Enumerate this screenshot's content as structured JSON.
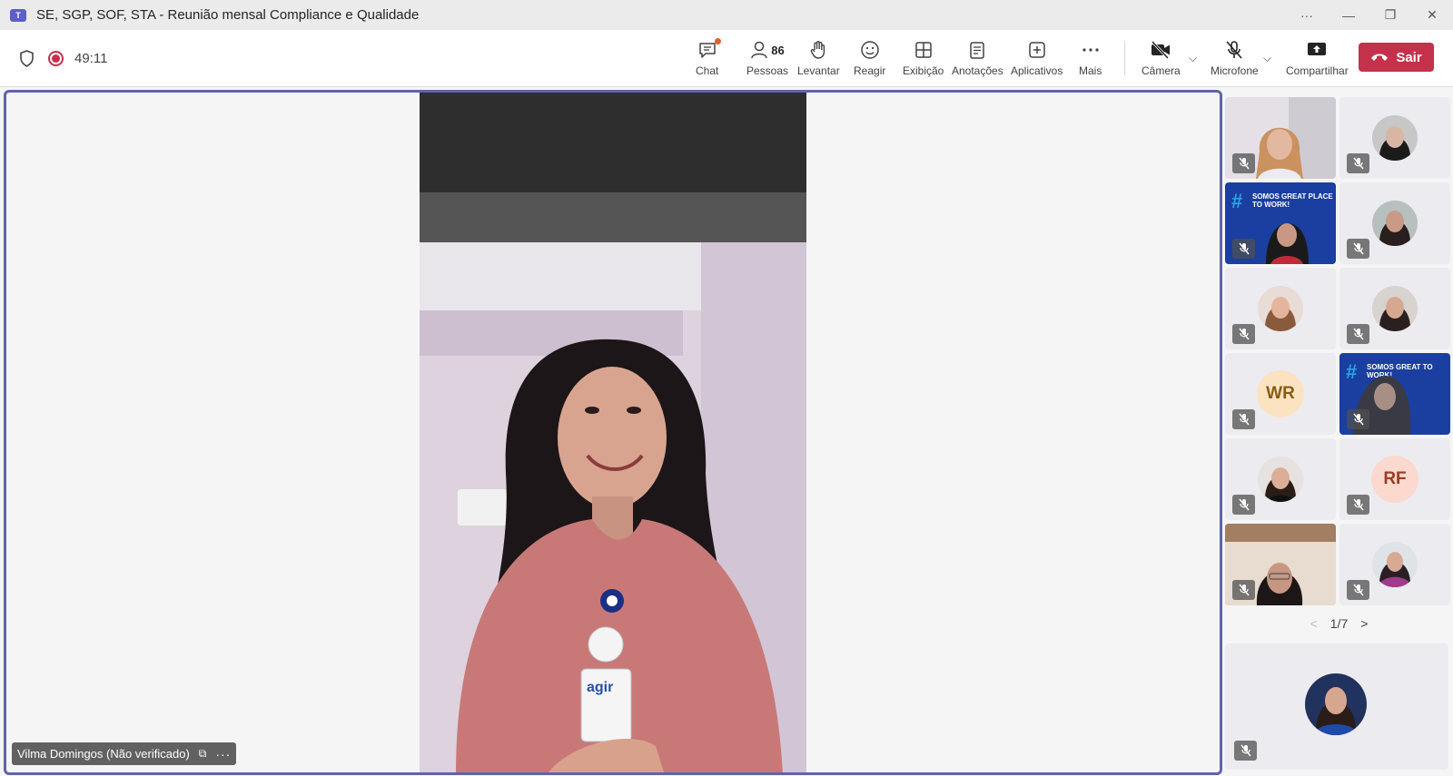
{
  "window": {
    "title": "SE, SGP, SOF, STA - Reunião mensal Compliance e Qualidade",
    "app_icon": "teams-icon"
  },
  "meeting": {
    "timer": "49:11",
    "recording": true
  },
  "toolbar": {
    "chat_label": "Chat",
    "people_label": "Pessoas",
    "people_count": "86",
    "raise_label": "Levantar",
    "react_label": "Reagir",
    "view_label": "Exibição",
    "notes_label": "Anotações",
    "apps_label": "Aplicativos",
    "more_label": "Mais",
    "camera_label": "Câmera",
    "mic_label": "Microfone",
    "share_label": "Compartilhar",
    "leave_label": "Sair"
  },
  "stage": {
    "speaker_name": "Vilma Domingos (Não verificado)"
  },
  "gallery": {
    "tiles": [
      {
        "type": "video"
      },
      {
        "type": "avatar"
      },
      {
        "type": "gptw",
        "text": "SOMOS GREAT PLACE TO WORK!"
      },
      {
        "type": "avatar"
      },
      {
        "type": "avatar"
      },
      {
        "type": "avatar"
      },
      {
        "type": "initials",
        "initials": "WR"
      },
      {
        "type": "gptw",
        "text": "SOMOS GREAT TO WORK!"
      },
      {
        "type": "avatar"
      },
      {
        "type": "initials",
        "initials": "RF"
      },
      {
        "type": "video"
      },
      {
        "type": "avatar"
      }
    ],
    "page": "1/7"
  },
  "colors": {
    "accent": "#6264a7",
    "leave": "#c4314b",
    "toolbar_bg": "#ffffff",
    "titlebar_bg": "#ebebeb"
  }
}
